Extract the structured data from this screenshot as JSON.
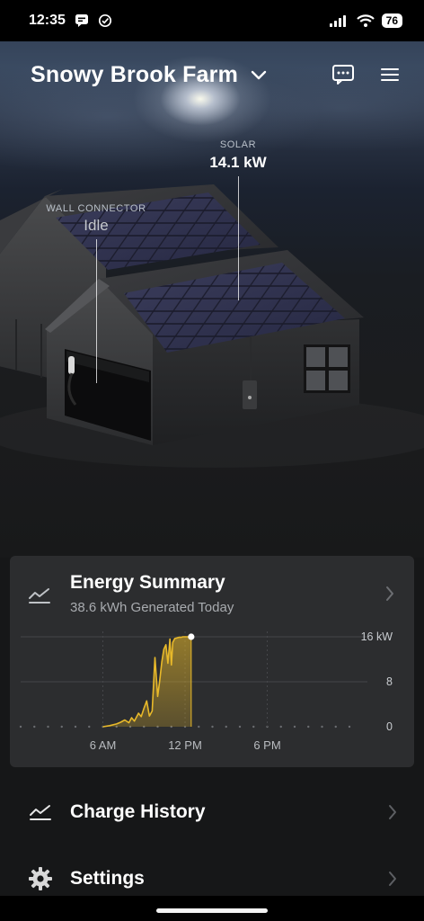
{
  "status_bar": {
    "time": "12:35",
    "battery": "76"
  },
  "header": {
    "title": "Snowy Brook Farm"
  },
  "scene": {
    "solar_label": "SOLAR",
    "solar_value": "14.1 kW",
    "wall_connector_label": "WALL CONNECTOR",
    "wall_connector_value": "Idle"
  },
  "energy_card": {
    "title": "Energy Summary",
    "subtitle": "38.6 kWh Generated Today"
  },
  "chart_data": {
    "type": "area",
    "x_ticks": [
      "6 AM",
      "12 PM",
      "6 PM"
    ],
    "y_ticks": [
      "0",
      "8",
      "16 kW"
    ],
    "ylim": [
      0,
      16
    ],
    "xlim_hours": [
      0,
      24
    ],
    "grid": true,
    "series": [
      {
        "color": "#e8b92a",
        "x_hours": [
          6.0,
          6.5,
          7.0,
          7.3,
          7.6,
          7.9,
          8.1,
          8.3,
          8.6,
          8.8,
          9.0,
          9.2,
          9.4,
          9.6,
          9.8,
          10.0,
          10.15,
          10.3,
          10.45,
          10.6,
          10.75,
          10.9,
          11.0,
          11.1,
          11.25,
          11.4,
          11.55,
          11.7,
          11.85,
          12.0,
          12.15,
          12.3,
          12.45
        ],
        "y_kw": [
          0.0,
          0.2,
          0.5,
          0.8,
          1.2,
          0.7,
          1.6,
          1.0,
          2.4,
          1.8,
          3.3,
          4.6,
          1.9,
          2.8,
          12.3,
          5.4,
          8.2,
          11.5,
          13.8,
          14.6,
          11.3,
          15.6,
          11.0,
          15.0,
          15.7,
          15.8,
          15.9,
          15.9,
          16.0,
          16.0,
          16.0,
          16.0,
          16.0
        ]
      }
    ]
  },
  "list": {
    "charge_history": "Charge History",
    "settings": "Settings"
  },
  "colors": {
    "accent_solar": "#e8b92a",
    "card_bg": "#2c2d2f",
    "page_bg": "#161718"
  },
  "icons": {
    "header_chevron": "chevron-down-icon",
    "messages": "chat-bubble-icon",
    "menu": "hamburger-menu-icon",
    "energy": "trend-line-icon",
    "charge_history": "trend-line-icon",
    "settings": "gear-icon"
  }
}
